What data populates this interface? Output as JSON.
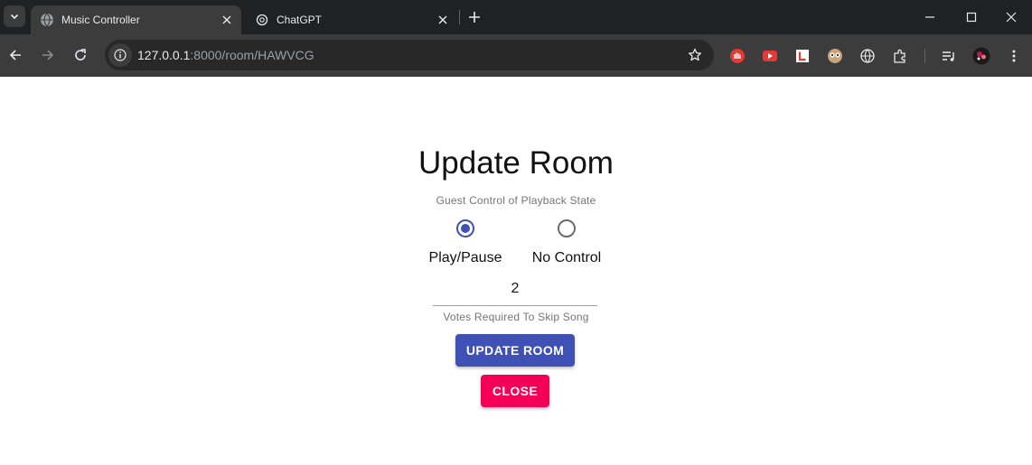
{
  "browser": {
    "tabs": [
      {
        "title": "Music Controller",
        "active": true,
        "icon": "globe-icon"
      },
      {
        "title": "ChatGPT",
        "active": false,
        "icon": "openai-icon"
      }
    ],
    "url": {
      "host": "127.0.0.1",
      "path": ":8000/room/HAWVCG"
    },
    "extensions": [
      "stop-extension-icon",
      "youtube-extension-icon",
      "l-extension-icon",
      "owl-extension-icon",
      "globe-extension-icon",
      "puzzle-extensions-icon"
    ],
    "colors": {
      "tabbar": "#202124",
      "toolbar": "#3c3c3c",
      "omnibox": "#282828"
    }
  },
  "page": {
    "heading": "Update Room",
    "playback_helper": "Guest Control of Playback State",
    "options": [
      {
        "label": "Play/Pause",
        "selected": true
      },
      {
        "label": "No Control",
        "selected": false
      }
    ],
    "votes_value": "2",
    "votes_helper": "Votes Required To Skip Song",
    "update_button": "UPDATE ROOM",
    "close_button": "CLOSE",
    "colors": {
      "primary": "#3f51b5",
      "secondary": "#f50057"
    }
  }
}
